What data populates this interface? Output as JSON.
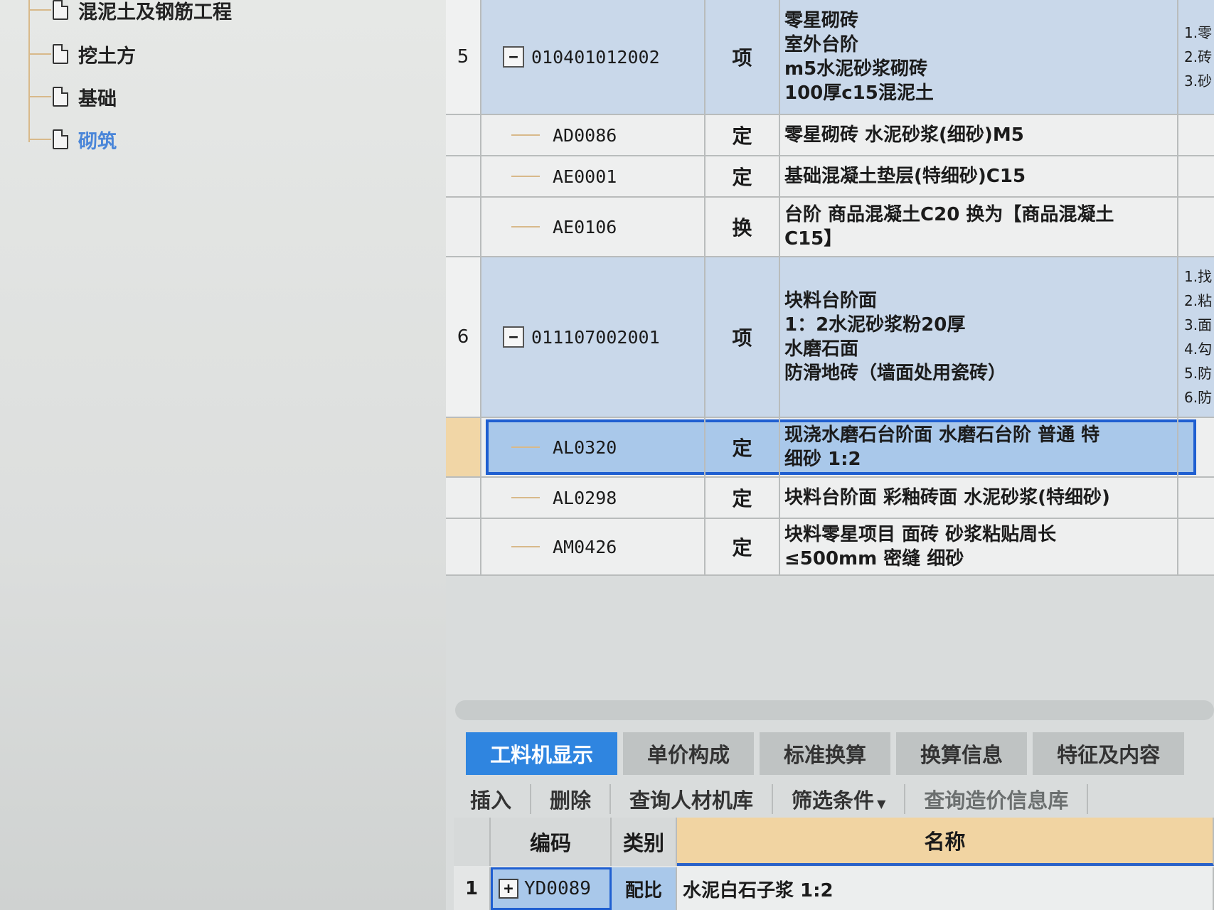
{
  "tree": {
    "items": [
      {
        "label": "混泥土及钢筋工程"
      },
      {
        "label": "挖土方"
      },
      {
        "label": "基础"
      },
      {
        "label": "砌筑"
      }
    ]
  },
  "grid": {
    "rows": [
      {
        "num": "5",
        "code": "010401012002",
        "type": "项",
        "name": "零星砌砖\n室外台阶\nm5水泥砂浆砌砖\n100厚c15混泥土",
        "extra": "1.零\n2.砖\n3.砂"
      },
      {
        "num": "",
        "code": "AD0086",
        "type": "定",
        "name": "零星砌砖  水泥砂浆(细砂)M5",
        "extra": ""
      },
      {
        "num": "",
        "code": "AE0001",
        "type": "定",
        "name": "基础混凝土垫层(特细砂)C15",
        "extra": ""
      },
      {
        "num": "",
        "code": "AE0106",
        "type": "换",
        "name": "台阶  商品混凝土C20   换为【商品混凝土\nC15】",
        "extra": ""
      },
      {
        "num": "6",
        "code": "011107002001",
        "type": "项",
        "name": "块料台阶面\n1：2水泥砂浆粉20厚\n水磨石面\n防滑地砖（墙面处用瓷砖）",
        "extra": "1.找\n2.粘\n3.面\n4.勾\n5.防\n6.防"
      },
      {
        "num": "",
        "code": "AL0320",
        "type": "定",
        "name": "现浇水磨石台阶面 水磨石台阶  普通  特\n细砂  1:2",
        "extra": ""
      },
      {
        "num": "",
        "code": "AL0298",
        "type": "定",
        "name": "块料台阶面  彩釉砖面  水泥砂浆(特细砂)",
        "extra": ""
      },
      {
        "num": "",
        "code": "AM0426",
        "type": "定",
        "name": "块料零星项目  面砖  砂浆粘贴周长\n≤500mm 密缝  细砂",
        "extra": ""
      }
    ]
  },
  "tabs": [
    {
      "label": "工料机显示"
    },
    {
      "label": "单价构成"
    },
    {
      "label": "标准换算"
    },
    {
      "label": "换算信息"
    },
    {
      "label": "特征及内容"
    }
  ],
  "toolbar": {
    "insert": "插入",
    "delete": "删除",
    "query_lib": "查询人材机库",
    "filter": "筛选条件",
    "query_price": "查询造价信息库"
  },
  "subgrid": {
    "headers": {
      "code": "编码",
      "category": "类别",
      "name": "名称"
    },
    "rows": [
      {
        "num": "1",
        "code": "YD0089",
        "category": "配比",
        "name": "水泥白石子浆  1:2"
      }
    ]
  },
  "colors": {
    "accent": "#2f85e0",
    "selection_border": "#1f5fd1",
    "item_row": "#c9d8ea"
  }
}
